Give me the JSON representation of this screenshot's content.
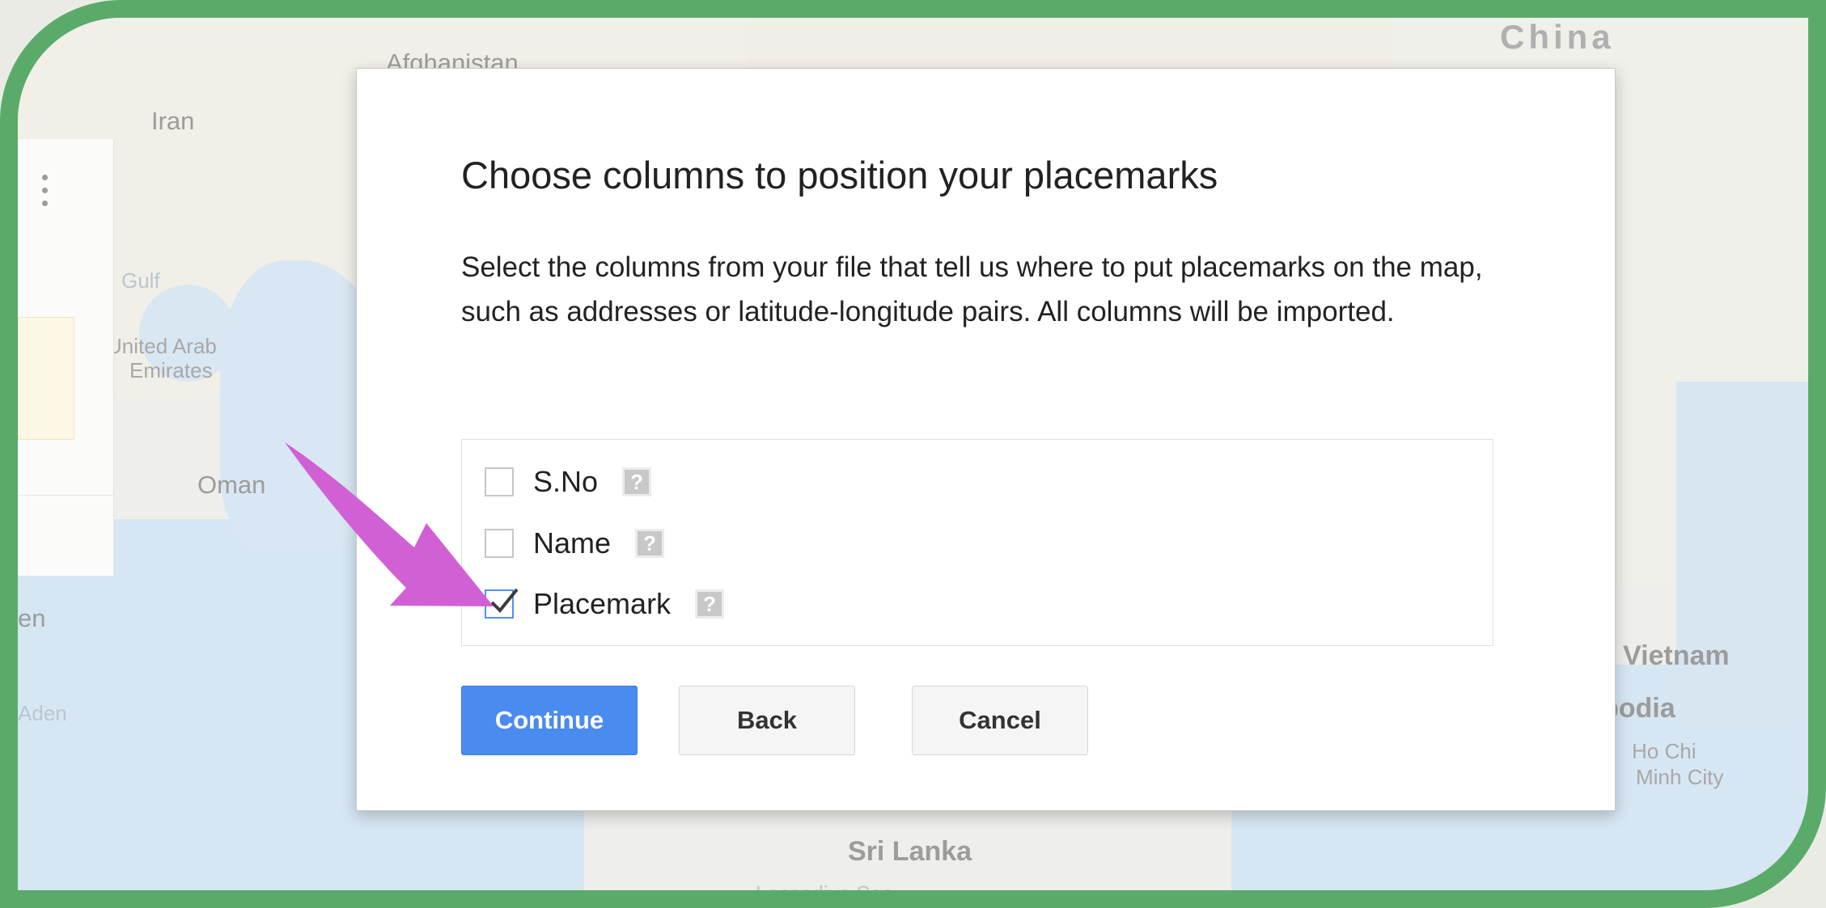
{
  "map": {
    "labels": {
      "afghanistan": "Afghanistan",
      "iran": "Iran",
      "china": "China",
      "gulf": "Gulf",
      "uae_line1": "United Arab",
      "uae_line2": "Emirates",
      "oman": "Oman",
      "yemen_partial": "en",
      "aden_partial": "Aden",
      "vietnam": "Vietnam",
      "cambodia_partial": "bodia",
      "hcmc_line1": "Ho Chi",
      "hcmc_line2": "Minh City",
      "sri_lanka": "Sri Lanka",
      "laccadive": "Laccadive Sea"
    }
  },
  "dialog": {
    "title": "Choose columns to position your placemarks",
    "description": "Select the columns from your file that tell us where to put placemarks on the map, such as addresses or latitude-longitude pairs. All columns will be imported.",
    "options": [
      {
        "label": "S.No",
        "checked": false,
        "help": "?"
      },
      {
        "label": "Name",
        "checked": false,
        "help": "?"
      },
      {
        "label": "Placemark",
        "checked": true,
        "help": "?"
      }
    ],
    "buttons": {
      "continue": "Continue",
      "back": "Back",
      "cancel": "Cancel"
    }
  },
  "colors": {
    "frame_border": "#5aab6a",
    "primary_button": "#4a8bef",
    "annotation_arrow": "#d160d4"
  }
}
